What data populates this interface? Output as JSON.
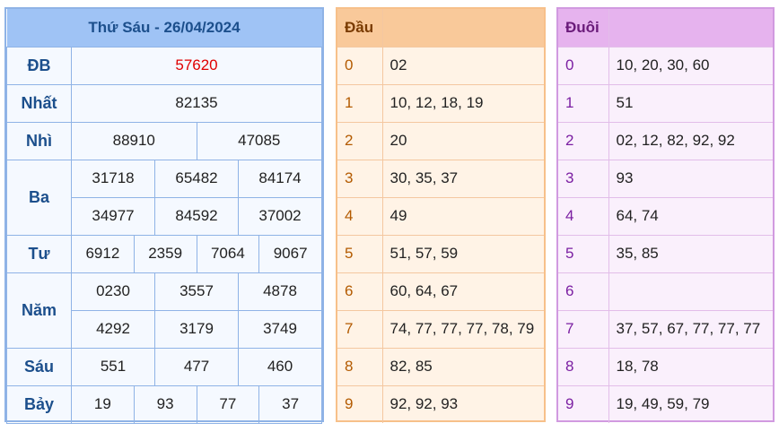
{
  "results": {
    "title": "Thứ Sáu - 26/04/2024",
    "prizes": {
      "db": {
        "label": "ĐB",
        "values": [
          "57620"
        ]
      },
      "nhat": {
        "label": "Nhất",
        "values": [
          "82135"
        ]
      },
      "nhi": {
        "label": "Nhì",
        "values": [
          "88910",
          "47085"
        ]
      },
      "ba": {
        "label": "Ba",
        "values": [
          "31718",
          "65482",
          "84174",
          "34977",
          "84592",
          "37002"
        ]
      },
      "tu": {
        "label": "Tư",
        "values": [
          "6912",
          "2359",
          "7064",
          "9067"
        ]
      },
      "nam": {
        "label": "Năm",
        "values": [
          "0230",
          "3557",
          "4878",
          "4292",
          "3179",
          "3749"
        ]
      },
      "sau": {
        "label": "Sáu",
        "values": [
          "551",
          "477",
          "460"
        ]
      },
      "bay": {
        "label": "Bảy",
        "values": [
          "19",
          "93",
          "77",
          "37"
        ]
      }
    },
    "special_color": "#e00000"
  },
  "dau": {
    "header": "Đầu",
    "rows": [
      {
        "key": "0",
        "value": "02"
      },
      {
        "key": "1",
        "value": "10, 12, 18, 19"
      },
      {
        "key": "2",
        "value": "20"
      },
      {
        "key": "3",
        "value": "30, 35, 37"
      },
      {
        "key": "4",
        "value": "49"
      },
      {
        "key": "5",
        "value": "51, 57, 59"
      },
      {
        "key": "6",
        "value": "60, 64, 67"
      },
      {
        "key": "7",
        "value": "74, 77, 77, 77, 78, 79"
      },
      {
        "key": "8",
        "value": "82, 85"
      },
      {
        "key": "9",
        "value": "92, 92, 93"
      }
    ]
  },
  "duoi": {
    "header": "Đuôi",
    "rows": [
      {
        "key": "0",
        "value": "10, 20, 30, 60"
      },
      {
        "key": "1",
        "value": "51"
      },
      {
        "key": "2",
        "value": "02, 12, 82, 92, 92"
      },
      {
        "key": "3",
        "value": "93"
      },
      {
        "key": "4",
        "value": "64, 74"
      },
      {
        "key": "5",
        "value": "35, 85"
      },
      {
        "key": "6",
        "value": ""
      },
      {
        "key": "7",
        "value": "37, 57, 67, 77, 77, 77"
      },
      {
        "key": "8",
        "value": "18, 78"
      },
      {
        "key": "9",
        "value": "19, 49, 59, 79"
      }
    ]
  }
}
